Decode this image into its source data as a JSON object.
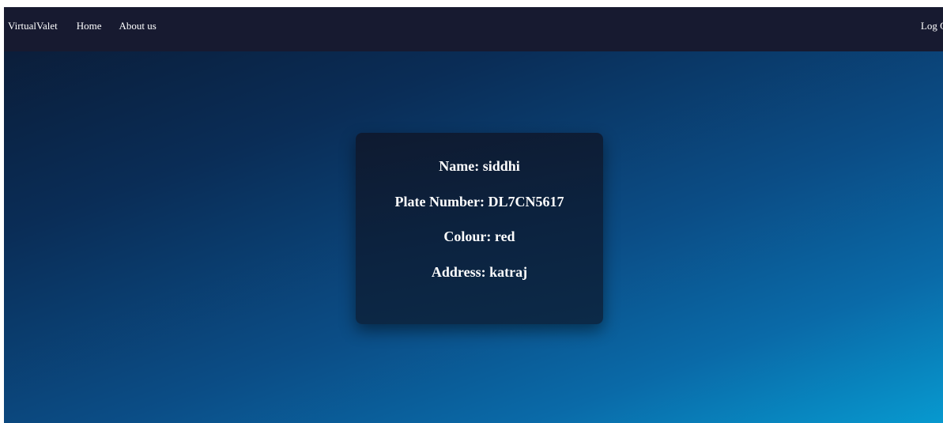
{
  "nav": {
    "brand": "VirtualValet",
    "home": "Home",
    "about": "About us",
    "logout": "Log Ou"
  },
  "details": {
    "name": "Name: siddhi",
    "plate": "Plate Number: DL7CN5617",
    "colour": "Colour: red",
    "address": "Address: katraj"
  },
  "colors": {
    "navbar": "#171a30",
    "card": "#0c2340",
    "gradient_start": "#0b1a33",
    "gradient_end": "#0799cf"
  }
}
